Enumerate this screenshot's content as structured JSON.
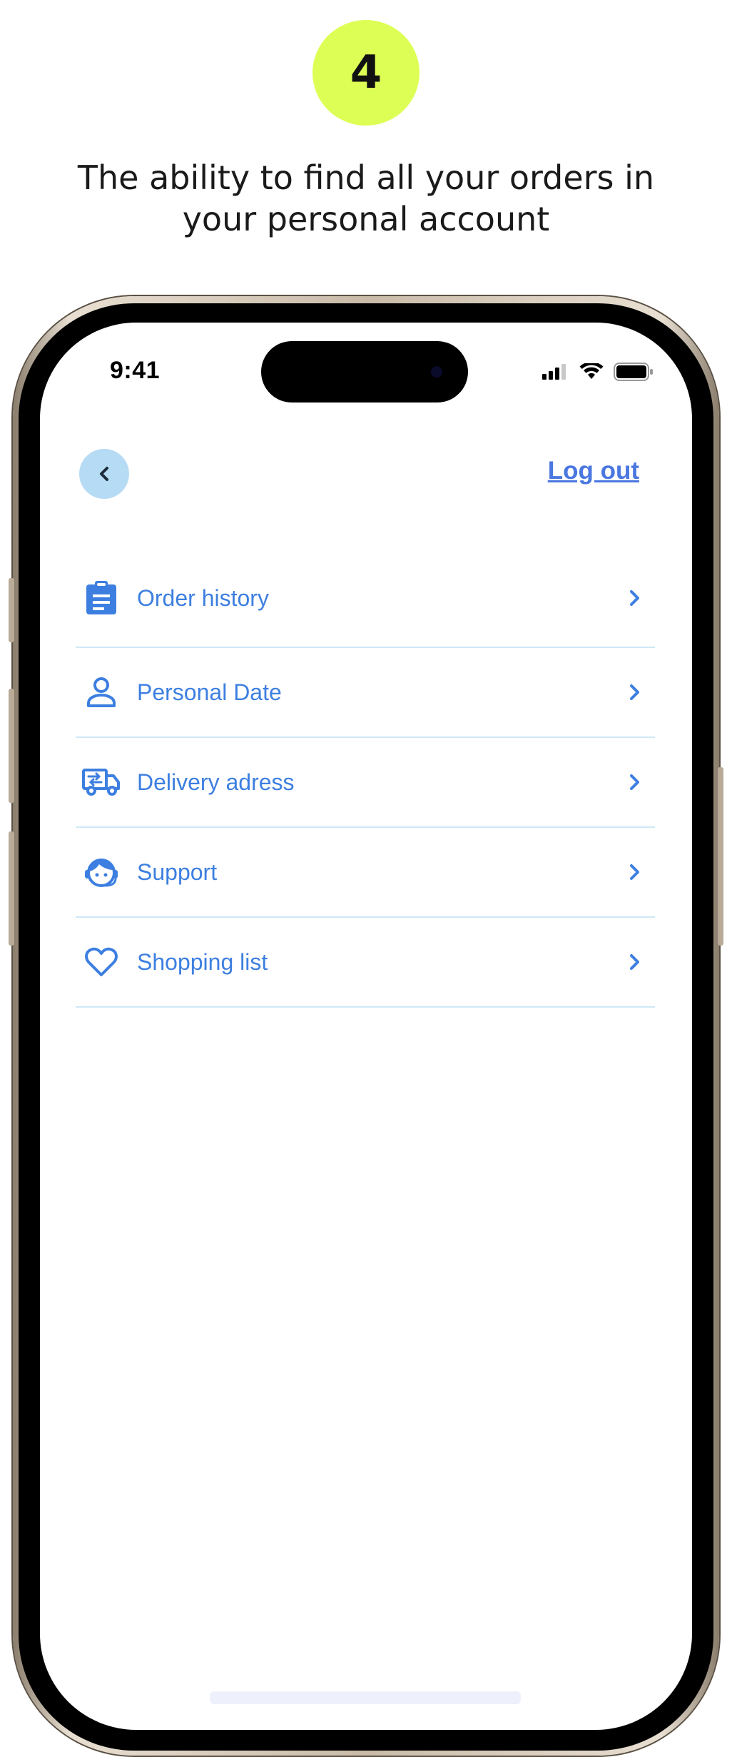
{
  "step": {
    "number": "4"
  },
  "caption": "The ability to find all your orders in your personal account",
  "status_bar": {
    "time": "9:41"
  },
  "header": {
    "logout_label": "Log out"
  },
  "menu": {
    "items": [
      {
        "label": "Order history",
        "icon": "clipboard-icon"
      },
      {
        "label": "Personal Date",
        "icon": "person-icon"
      },
      {
        "label": "Delivery adress",
        "icon": "truck-icon"
      },
      {
        "label": "Support",
        "icon": "support-agent-icon"
      },
      {
        "label": "Shopping list",
        "icon": "heart-icon"
      }
    ]
  },
  "colors": {
    "accent": "#3d7fe0",
    "badge": "#ddff55",
    "back_button": "#b6dbf4",
    "divider": "#cfe9f6"
  }
}
